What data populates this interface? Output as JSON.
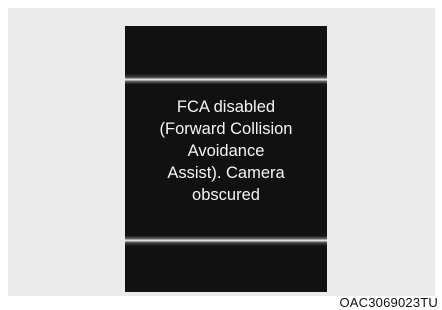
{
  "display": {
    "message": "FCA disabled\n(Forward Collision\nAvoidance\nAssist). Camera\nobscured"
  },
  "caption": {
    "code": "OAC3069023TU"
  },
  "colors": {
    "screen": "#111111",
    "frame": "#eaeaea",
    "text": "#f4f4f4"
  }
}
